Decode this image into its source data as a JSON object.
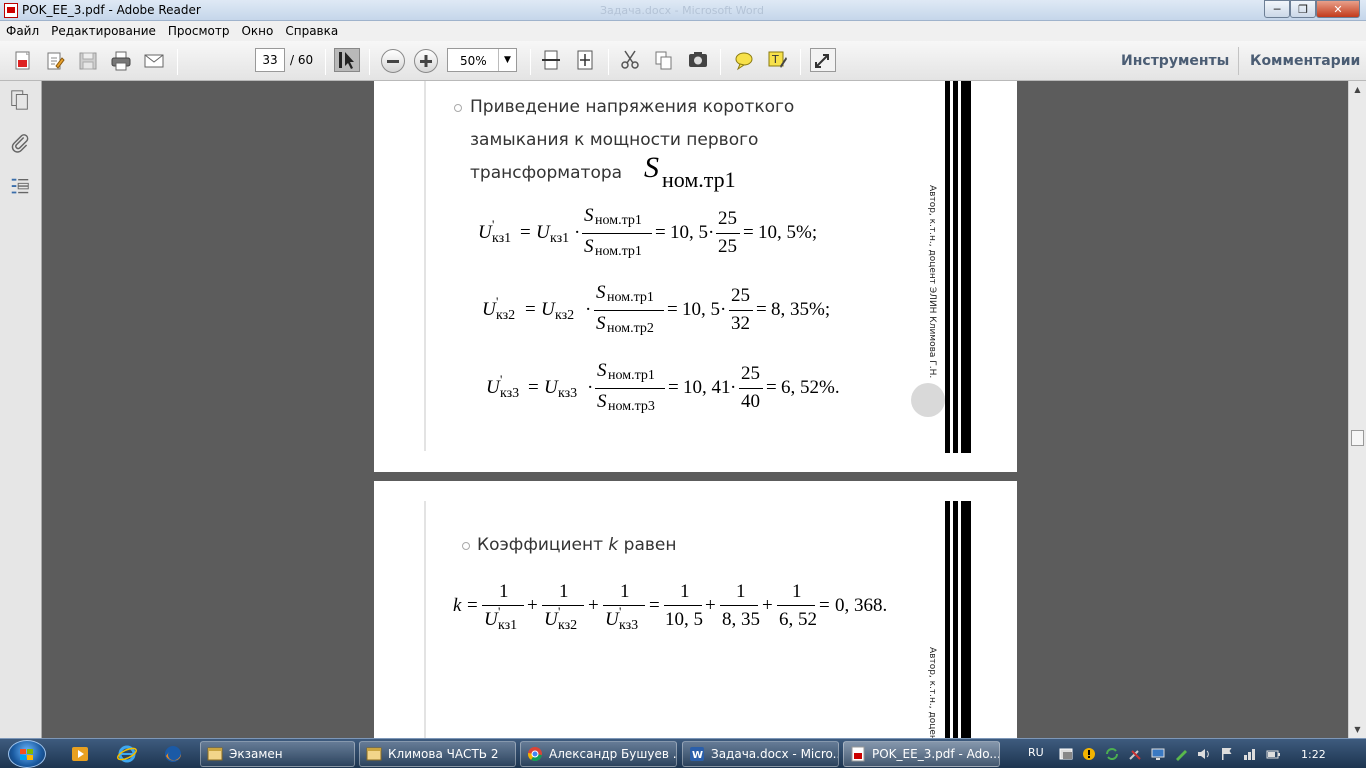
{
  "window": {
    "title": "POK_EE_3.pdf - Adobe Reader",
    "background_title": "Задача.docx - Microsoft Word"
  },
  "menu": [
    "Файл",
    "Редактирование",
    "Просмотр",
    "Окно",
    "Справка"
  ],
  "toolbar": {
    "page_current": "33",
    "page_total": "/ 60",
    "zoom": "50%",
    "tools_label": "Инструменты",
    "comments_label": "Комментарии"
  },
  "document": {
    "page1": {
      "bullet_text_lines": [
        "Приведение напряжения короткого",
        "замыкания к мощности первого",
        "трансформатора"
      ],
      "bullet_symbol": "S",
      "bullet_symbol_sub": "ном.тр1",
      "side_text": "Автор, к.т.н., доцент ЭЛИН Климова Г.Н.",
      "eq1": {
        "lhs_var": "U",
        "lhs_sub": "кз1",
        "rhs_var": "U",
        "rhs_sub": "кз1",
        "num": "S",
        "num_sub": "ном.тр1",
        "den": "S",
        "den_sub": "ном.тр1",
        "coef": "10, 5",
        "frac_num": "25",
        "frac_den": "25",
        "result": "10, 5%;"
      },
      "eq2": {
        "lhs_var": "U",
        "lhs_sub": "кз2",
        "rhs_var": "U",
        "rhs_sub": "кз2",
        "num": "S",
        "num_sub": "ном.тр1",
        "den": "S",
        "den_sub": "ном.тр2",
        "coef": "10, 5",
        "frac_num": "25",
        "frac_den": "32",
        "result": "8, 35%;"
      },
      "eq3": {
        "lhs_var": "U",
        "lhs_sub": "кз3",
        "rhs_var": "U",
        "rhs_sub": "кз3",
        "num": "S",
        "num_sub": "ном.тр1",
        "den": "S",
        "den_sub": "ном.тр3",
        "coef": "10, 41",
        "frac_num": "25",
        "frac_den": "40",
        "result": "6, 52%."
      }
    },
    "page2": {
      "bullet_text_pre": "Коэффициент ",
      "bullet_text_var": "k",
      "bullet_text_post": " равен",
      "side_text": "Автор, к.т.н., доцент",
      "k_eq": {
        "lhs": "k",
        "one": "1",
        "u": "U",
        "subs": [
          "кз1",
          "кз2",
          "кз3"
        ],
        "dens": [
          "10, 5",
          "8, 35",
          "6, 52"
        ],
        "result": "0, 368."
      }
    }
  },
  "taskbar": {
    "tasks": [
      "Экзамен",
      "Климова ЧАСТЬ 2",
      "Александр Бушуев ...",
      "Задача.docx - Micro...",
      "POK_EE_3.pdf - Ado..."
    ],
    "lang": "RU",
    "clock": "1:22"
  },
  "colors": {
    "doc_bg": "#5c5c5c",
    "toolbar_text": "#4b5d74",
    "taskbar": "#1d3550"
  }
}
